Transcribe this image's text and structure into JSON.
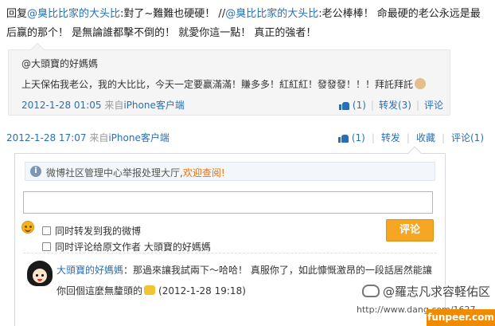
{
  "post": {
    "reply_prefix": "回复",
    "mention1": "@臭比比家的大头比",
    "text1": ":對了~難難也硬硬！ //",
    "mention2": "@臭比比家的大头比",
    "text2": ":老公棒棒！ 命最硬的老公永远是最后赢的那个！ 是無論誰都擊不倒的！ 就愛你這一點！ 真正的強者！"
  },
  "repost": {
    "author": "@大頭寶的好媽媽",
    "text": "上天保佑我老公，我的大比比，今天一定要赢滿滿！賺多多！紅紅紅！發發發！！！拜託拜託",
    "time": "2012-1-28 01:05",
    "source_prefix": "来自",
    "source": "iPhone客户端",
    "like_label": "(1)",
    "forward_label": "转发(3)",
    "comment_label": "评论"
  },
  "main_meta": {
    "time": "2012-1-28 17:07",
    "source_prefix": "来自",
    "source": "iPhone客户端",
    "like_label": "(1)",
    "forward_label": "转发",
    "favorite_label": "收藏",
    "comment_label": "评论(1)"
  },
  "comment_panel": {
    "notice_text": "微博社区管理中心举报处理大厅,",
    "notice_link": "欢迎查阅!",
    "input_value": "",
    "check1_label": "同时转发到我的微博",
    "check2_label": "同时评论给原文作者 大頭寶的好媽媽",
    "submit_label": "评论"
  },
  "comment": {
    "author": "大頭寶的好媽媽",
    "text1": "：那過來讓我試兩下～哈哈！  真服你了，如此慷慨激昂的一段話居然能讓",
    "text2": "你回個這麼無釐頭的",
    "time": "(2012-1-28 19:18)"
  },
  "watermark": {
    "line1": "@羅志凡求容軽佑区",
    "line2": "http://www.dang.com/1627",
    "brand": "funpeer.com"
  },
  "colors": {
    "link": "#2a6fb5",
    "accent_orange": "#f5a623",
    "notice_link": "#e7720e"
  }
}
